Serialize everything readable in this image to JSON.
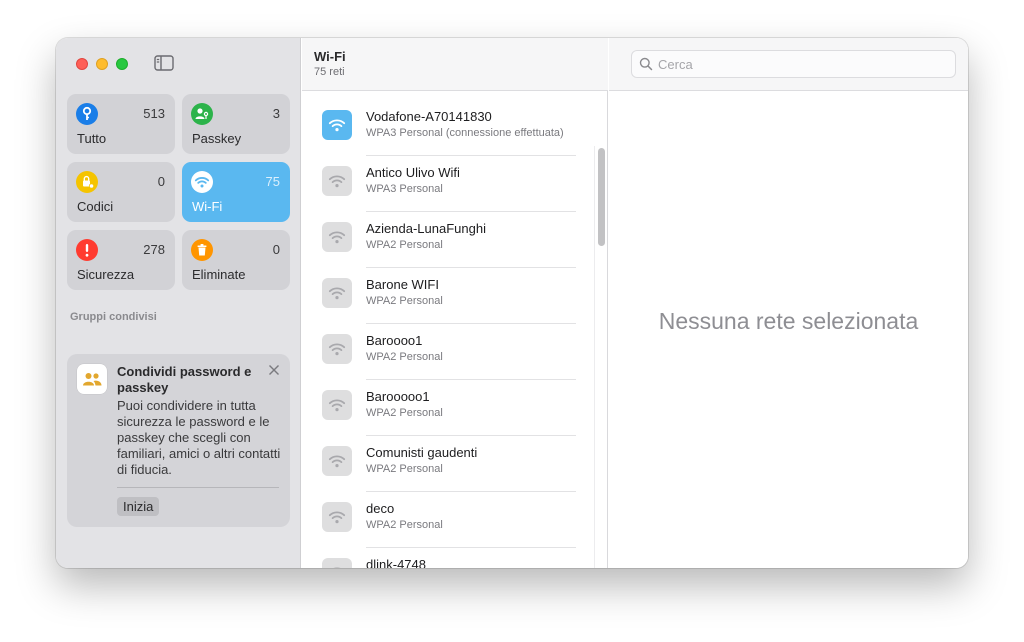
{
  "sidebar": {
    "categories": [
      {
        "label": "Tutto",
        "count": "513",
        "icon": "key-icon",
        "color": "#1a7ee8"
      },
      {
        "label": "Passkey",
        "count": "3",
        "icon": "person-key-icon",
        "color": "#2cb34a"
      },
      {
        "label": "Codici",
        "count": "0",
        "icon": "lock-code-icon",
        "color": "#f5c400"
      },
      {
        "label": "Wi-Fi",
        "count": "75",
        "icon": "wifi-icon",
        "color": "#5ab8f0",
        "selected": true
      },
      {
        "label": "Sicurezza",
        "count": "278",
        "icon": "exclamation-icon",
        "color": "#ff3b30"
      },
      {
        "label": "Eliminate",
        "count": "0",
        "icon": "trash-icon",
        "color": "#ff9500"
      }
    ],
    "group_header": "Gruppi condivisi",
    "share_card": {
      "title": "Condividi password e passkey",
      "body": "Puoi condividere in tutta sicurezza le password e le passkey che scegli con familiari, amici o altri contatti di fiducia.",
      "button": "Inizia"
    }
  },
  "list": {
    "title": "Wi-Fi",
    "subtitle": "75 reti",
    "networks": [
      {
        "name": "Vodafone-A70141830",
        "security": "WPA3 Personal (connessione effettuata)",
        "active": true
      },
      {
        "name": "Antico Ulivo Wifi",
        "security": "WPA3 Personal"
      },
      {
        "name": "Azienda-LunaFunghi",
        "security": "WPA2 Personal"
      },
      {
        "name": "Barone WIFI",
        "security": "WPA2 Personal"
      },
      {
        "name": "Baroooo1",
        "security": "WPA2 Personal"
      },
      {
        "name": "Barooooo1",
        "security": "WPA2 Personal"
      },
      {
        "name": "Comunisti gaudenti",
        "security": "WPA2 Personal"
      },
      {
        "name": "deco",
        "security": "WPA2 Personal"
      },
      {
        "name": "dlink-4748",
        "security": ""
      }
    ]
  },
  "detail": {
    "search_placeholder": "Cerca",
    "empty_text": "Nessuna rete selezionata"
  }
}
